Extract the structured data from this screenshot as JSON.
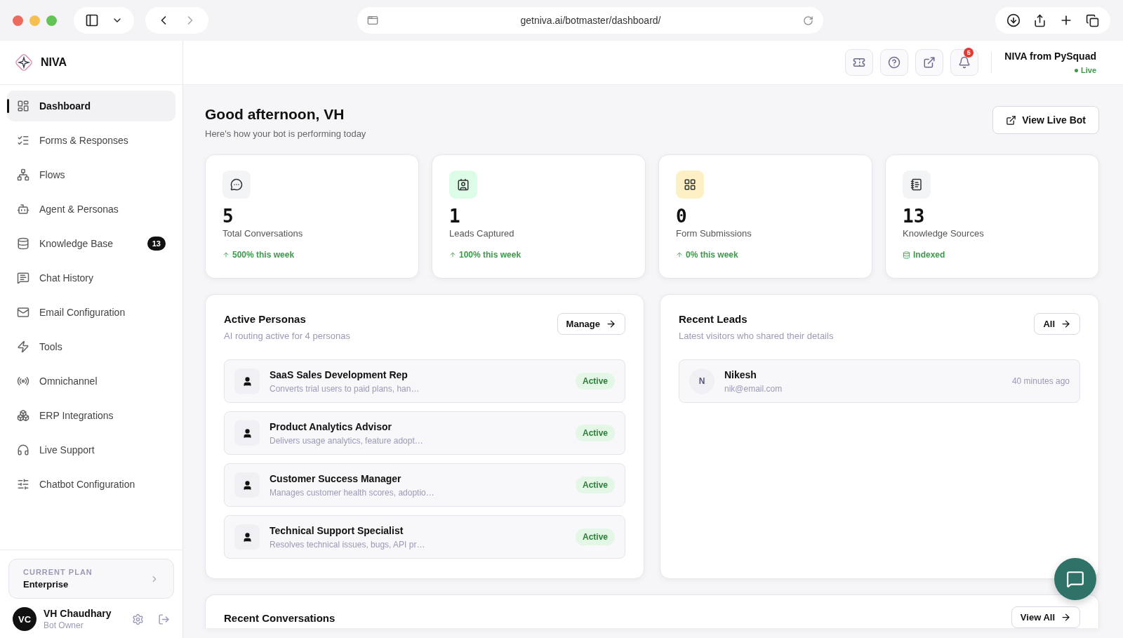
{
  "browser": {
    "url": "getniva.ai/botmaster/dashboard/"
  },
  "sidebar": {
    "brand": "NIVA",
    "items": [
      {
        "label": "Dashboard",
        "selected": true
      },
      {
        "label": "Forms & Responses",
        "selected": false
      },
      {
        "label": "Flows",
        "selected": false
      },
      {
        "label": "Agent & Personas",
        "selected": false
      },
      {
        "label": "Knowledge Base",
        "selected": false,
        "badge": "13"
      },
      {
        "label": "Chat History",
        "selected": false
      },
      {
        "label": "Email Configuration",
        "selected": false
      },
      {
        "label": "Tools",
        "selected": false
      },
      {
        "label": "Omnichannel",
        "selected": false
      },
      {
        "label": "ERP Integrations",
        "selected": false
      },
      {
        "label": "Live Support",
        "selected": false
      },
      {
        "label": "Chatbot Configuration",
        "selected": false
      }
    ],
    "plan": {
      "label": "CURRENT PLAN",
      "name": "Enterprise"
    },
    "user": {
      "initials": "VC",
      "name": "VH Chaudhary",
      "role": "Bot Owner"
    }
  },
  "header": {
    "bot_name": "NIVA from PySquad",
    "status": "Live",
    "notification_count": "5"
  },
  "greeting": {
    "title": "Good afternoon, VH",
    "subtitle": "Here's how your bot is performing today",
    "button": "View Live Bot"
  },
  "stats": [
    {
      "value": "5",
      "label": "Total Conversations",
      "note": "500% this week",
      "kind": "trend",
      "color": "#f3f4f6"
    },
    {
      "value": "1",
      "label": "Leads Captured",
      "note": "100% this week",
      "kind": "trend",
      "color": "#dcfce7"
    },
    {
      "value": "0",
      "label": "Form Submissions",
      "note": "0% this week",
      "kind": "trend",
      "color": "#fdf0c4"
    },
    {
      "value": "13",
      "label": "Knowledge Sources",
      "note": "Indexed",
      "kind": "indexed",
      "color": "#f3f4f6"
    }
  ],
  "personas": {
    "title": "Active Personas",
    "subtitle": "AI routing active for 4 personas",
    "button": "Manage",
    "items": [
      {
        "name": "SaaS Sales Development Rep",
        "description": "Converts trial users to paid plans, han…",
        "status": "Active"
      },
      {
        "name": "Product Analytics Advisor",
        "description": "Delivers usage analytics, feature adopt…",
        "status": "Active"
      },
      {
        "name": "Customer Success Manager",
        "description": "Manages customer health scores, adoptio…",
        "status": "Active"
      },
      {
        "name": "Technical Support Specialist",
        "description": "Resolves technical issues, bugs, API pr…",
        "status": "Active"
      }
    ]
  },
  "leads": {
    "title": "Recent Leads",
    "subtitle": "Latest visitors who shared their details",
    "button": "All",
    "items": [
      {
        "initial": "N",
        "name": "Nikesh",
        "email": "nik@email.com",
        "time": "40 minutes ago"
      }
    ]
  },
  "conversations": {
    "title": "Recent Conversations",
    "button": "View All"
  }
}
